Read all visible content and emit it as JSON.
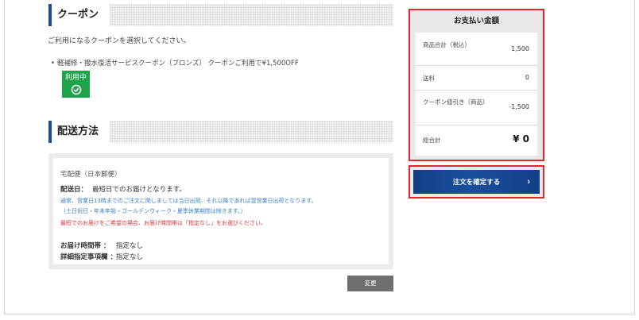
{
  "coupon_section": {
    "title": "クーポン",
    "description": "ご利用になるクーポンを選択してください。",
    "item_bullet": "•",
    "item_text": "軽補修・撥水復活サービスクーポン（ブロンズ） クーポンご利用で¥1,500OFF",
    "badge_label": "利用中",
    "badge_color": "#1fa34a"
  },
  "shipping_section": {
    "title": "配送方法",
    "method": "宅配便（日本郵便）",
    "delivery_label": "配送日：",
    "delivery_value": "最短日でのお届けとなります。",
    "note_line1": "通常、営業日13時までのご注文に関しましては当日出荷、それ以降であれば翌営業日出荷となります。",
    "note_line2": "（土日祝日・年末年始・ゴールデンウィーク・夏季休業期間は除きます。）",
    "note_line3": "最短でのお届けをご希望の場合、お届け時間帯は「指定なし」をお選びください。",
    "time_label": "お届け時間帯 ：",
    "time_value": "指定なし",
    "detail_label": "詳細指定事項欄 ：",
    "detail_value": "指定なし",
    "change_button": "変更"
  },
  "summary": {
    "title": "お支払い金額",
    "rows": [
      {
        "label": "商品合計（税込）",
        "value": "1,500"
      },
      {
        "label": "送料",
        "value": "0"
      },
      {
        "label": "クーポン値引き（商品）",
        "value": "-1,500"
      },
      {
        "label": "総合計",
        "value": "¥ 0"
      }
    ],
    "confirm_button": "注文を確定する",
    "confirm_chevron": "›"
  },
  "colors": {
    "accent_blue": "#1f4a8f",
    "highlight_red": "#e3262c",
    "note_blue": "#3b82c4",
    "note_red": "#e0333a"
  }
}
